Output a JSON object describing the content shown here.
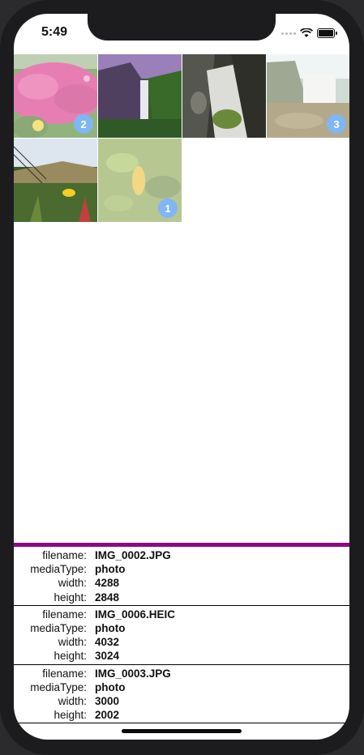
{
  "status": {
    "time": "5:49"
  },
  "grid": {
    "photos": [
      {
        "badge": "2",
        "selected": true
      },
      {
        "badge": "",
        "selected": false
      },
      {
        "badge": "",
        "selected": false
      },
      {
        "badge": "3",
        "selected": true
      },
      {
        "badge": "",
        "selected": false
      },
      {
        "badge": "1",
        "selected": true
      }
    ]
  },
  "labels": {
    "filename": "filename:",
    "mediaType": "mediaType:",
    "width": "width:",
    "height": "height:"
  },
  "assets": [
    {
      "filename": "IMG_0002.JPG",
      "mediaType": "photo",
      "width": "4288",
      "height": "2848"
    },
    {
      "filename": "IMG_0006.HEIC",
      "mediaType": "photo",
      "width": "4032",
      "height": "3024"
    },
    {
      "filename": "IMG_0003.JPG",
      "mediaType": "photo",
      "width": "3000",
      "height": "2002"
    }
  ],
  "colors": {
    "divider": "#8a0a86",
    "badge": "#7fb6f6"
  }
}
